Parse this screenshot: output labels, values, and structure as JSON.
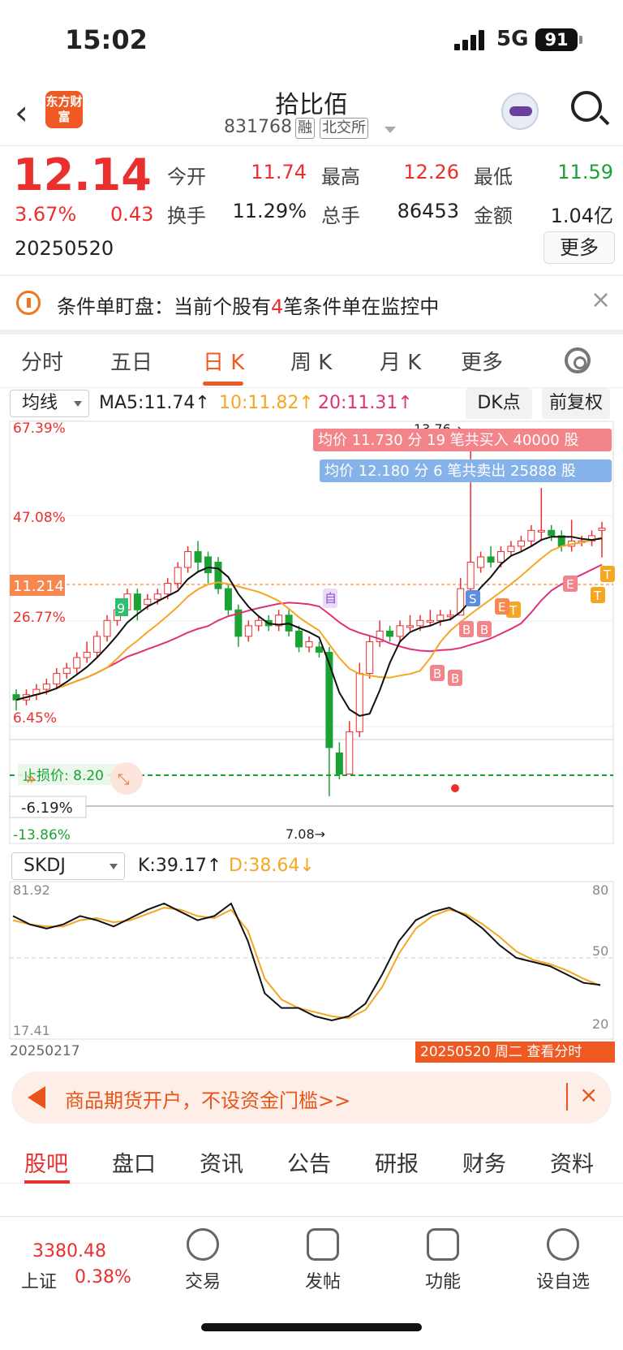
{
  "status": {
    "time": "15:02",
    "network": "5G",
    "battery": "91"
  },
  "header": {
    "back_icon": "‹",
    "logo_text": "东方财富",
    "title": "拾比佰",
    "code": "831768",
    "tag_margin": "融",
    "tag_exchange": "北交所"
  },
  "quote": {
    "price": "12.14",
    "change_pct": "3.67%",
    "change_amt": "0.43",
    "date": "20250520",
    "open_label": "今开",
    "open": "11.74",
    "high_label": "最高",
    "high": "12.26",
    "low_label": "最低",
    "low": "11.59",
    "turnover_label": "换手",
    "turnover": "11.29%",
    "volume_label": "总手",
    "volume": "86453",
    "amount_label": "金额",
    "amount": "1.04亿",
    "more_label": "更多"
  },
  "notice": {
    "prefix": "条件单盯盘：当前个股有",
    "count": "4",
    "suffix": "笔条件单在监控中",
    "close": "×"
  },
  "tabs": [
    "分时",
    "五日",
    "日 K",
    "周 K",
    "月 K",
    "更多"
  ],
  "toolbar": {
    "indicator": "均线",
    "ma5": "MA5:11.74↑",
    "ma10": "10:11.82↑",
    "ma20": "20:11.31↑",
    "dk_label": "DK点",
    "adjust_label": "前复权"
  },
  "main_chart": {
    "pct_labels": [
      "67.39%",
      "47.08%",
      "26.77%",
      "6.45%",
      "-13.86%"
    ],
    "price_marker": "11.214",
    "stop_label": "止损价: 8.20",
    "pct_marker": "-6.19%",
    "high_note": "13.76→",
    "low_note": "7.08→",
    "buy_banner": "均价 11.730 分 19 笔共买入 40000 股",
    "sell_banner": "均价 12.180 分 6 笔共卖出 25888 股",
    "nine_badge": "9",
    "buy_mark": "B",
    "sell_mark": "S",
    "take_mark": "T",
    "e_mark": "E",
    "ma_label": "自"
  },
  "chart_data": {
    "type": "candlestick",
    "ylim": [
      7.08,
      13.76
    ],
    "open": [
      9.0,
      8.9,
      9.0,
      9.1,
      9.2,
      9.4,
      9.5,
      9.7,
      9.8,
      10.1,
      10.4,
      10.6,
      10.9,
      10.7,
      10.8,
      10.9,
      11.1,
      11.4,
      11.7,
      11.6,
      11.5,
      11.0,
      10.6,
      10.1,
      10.3,
      10.4,
      10.3,
      10.5,
      10.2,
      9.9,
      9.9,
      9.8,
      7.9,
      7.5,
      8.3,
      9.4,
      10.0,
      10.2,
      10.1,
      10.3,
      10.3,
      10.4,
      10.4,
      10.5,
      10.5,
      11.0,
      11.4,
      11.6,
      11.5,
      11.7,
      11.8,
      11.9,
      12.1,
      12.1,
      12.0,
      11.8,
      11.9,
      11.9,
      12.1
    ],
    "close": [
      8.9,
      9.0,
      9.1,
      9.2,
      9.4,
      9.5,
      9.7,
      9.8,
      10.1,
      10.4,
      10.6,
      10.9,
      10.6,
      10.8,
      10.9,
      11.1,
      11.4,
      11.7,
      11.5,
      11.3,
      11.0,
      10.6,
      10.1,
      10.3,
      10.4,
      10.3,
      10.5,
      10.2,
      9.9,
      10.0,
      9.8,
      8.0,
      7.5,
      8.3,
      9.4,
      10.0,
      10.2,
      10.1,
      10.3,
      10.3,
      10.4,
      10.4,
      10.5,
      10.5,
      11.0,
      11.5,
      11.6,
      11.5,
      11.7,
      11.8,
      11.9,
      12.1,
      12.1,
      12.0,
      11.8,
      11.9,
      11.9,
      12.0,
      12.14
    ],
    "high": [
      9.1,
      9.1,
      9.2,
      9.3,
      9.5,
      9.6,
      9.8,
      10.0,
      10.2,
      10.5,
      10.8,
      11.0,
      11.0,
      10.9,
      11.0,
      11.2,
      11.5,
      11.8,
      11.9,
      11.7,
      11.6,
      11.1,
      10.7,
      10.4,
      10.5,
      10.5,
      10.6,
      10.6,
      10.3,
      10.1,
      10.0,
      9.9,
      8.1,
      8.5,
      9.6,
      10.1,
      10.4,
      10.3,
      10.4,
      10.5,
      10.5,
      10.6,
      10.6,
      10.6,
      11.2,
      13.76,
      11.7,
      11.8,
      11.8,
      11.9,
      12.0,
      12.2,
      12.9,
      12.2,
      12.1,
      12.3,
      12.0,
      12.1,
      12.26
    ],
    "low": [
      8.7,
      8.8,
      8.9,
      9.0,
      9.1,
      9.3,
      9.4,
      9.6,
      9.7,
      10.0,
      10.3,
      10.5,
      10.4,
      10.6,
      10.7,
      10.8,
      11.0,
      11.3,
      11.3,
      11.1,
      10.9,
      10.5,
      9.9,
      10.0,
      10.2,
      10.2,
      10.2,
      10.1,
      9.8,
      9.8,
      9.7,
      7.08,
      7.4,
      7.5,
      8.2,
      9.3,
      9.9,
      10.0,
      10.0,
      10.2,
      10.2,
      10.3,
      10.3,
      10.4,
      10.5,
      10.9,
      11.3,
      11.4,
      11.4,
      11.6,
      11.7,
      11.8,
      11.9,
      11.9,
      11.7,
      11.7,
      11.8,
      11.8,
      11.59
    ]
  },
  "skdj": {
    "indicator": "SKDJ",
    "k_text": "K:39.17↑",
    "d_text": "D:38.64↓",
    "top_left": "81.92",
    "bottom_left": "17.41",
    "right_labels": [
      "80",
      "50",
      "20"
    ],
    "start_date": "20250217",
    "end_banner": "20250520 周二 查看分时",
    "k": [
      72,
      68,
      66,
      68,
      72,
      70,
      67,
      71,
      75,
      78,
      74,
      70,
      72,
      78,
      60,
      35,
      28,
      28,
      24,
      22,
      24,
      30,
      44,
      60,
      70,
      74,
      76,
      72,
      66,
      58,
      52,
      50,
      48,
      44,
      40,
      39
    ],
    "d": [
      70,
      68,
      67,
      67,
      70,
      71,
      69,
      70,
      73,
      76,
      75,
      72,
      71,
      75,
      65,
      42,
      32,
      28,
      26,
      24,
      23,
      27,
      38,
      54,
      66,
      72,
      75,
      73,
      68,
      62,
      55,
      51,
      49,
      46,
      42,
      38.64
    ]
  },
  "ad": {
    "text": "商品期货开户，不设资金门槛>>",
    "close": "×"
  },
  "bottom_tabs": [
    "股吧",
    "盘口",
    "资讯",
    "公告",
    "研报",
    "财务",
    "资料"
  ],
  "nav": {
    "index_value": "3380.48",
    "index_name": "上证",
    "index_pct": "0.38%",
    "items": [
      "交易",
      "发帖",
      "功能",
      "设自选"
    ]
  },
  "colors": {
    "up": "#e9302f",
    "down": "#1aa334",
    "brand": "#f05a22",
    "ma5": "#111111",
    "ma10": "#f5a623",
    "ma20": "#e0307a"
  }
}
